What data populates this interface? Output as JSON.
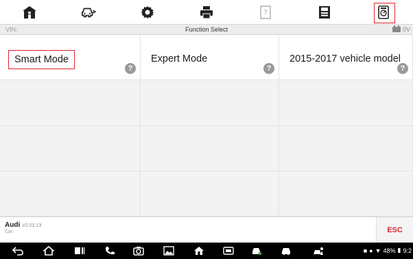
{
  "toolbar": {
    "buttons": [
      {
        "icon": "home-icon",
        "state": "normal"
      },
      {
        "icon": "vehicle-swap-icon",
        "state": "normal"
      },
      {
        "icon": "settings-icon",
        "state": "normal"
      },
      {
        "icon": "print-icon",
        "state": "normal"
      },
      {
        "icon": "help-icon",
        "state": "disabled"
      },
      {
        "icon": "save-icon",
        "state": "normal"
      },
      {
        "icon": "data-logging-icon",
        "state": "selected"
      }
    ]
  },
  "status_bar": {
    "vin_label": "VIN:",
    "title": "Function Select",
    "battery_text": "0V"
  },
  "functions": [
    {
      "label": "Smart Mode",
      "selected": true
    },
    {
      "label": "Expert Mode",
      "selected": false
    },
    {
      "label": "2015-2017 vehicle model",
      "selected": false
    }
  ],
  "footer": {
    "brand": "Audi",
    "version": "V2.02.13",
    "car_label": "Car:",
    "esc_label": "ESC"
  },
  "android_nav": {
    "battery_percent": "48%",
    "time": "9:2"
  },
  "colors": {
    "accent": "#e0232b",
    "grid_bg": "#f3f3f3",
    "status_bg": "#ececec"
  }
}
